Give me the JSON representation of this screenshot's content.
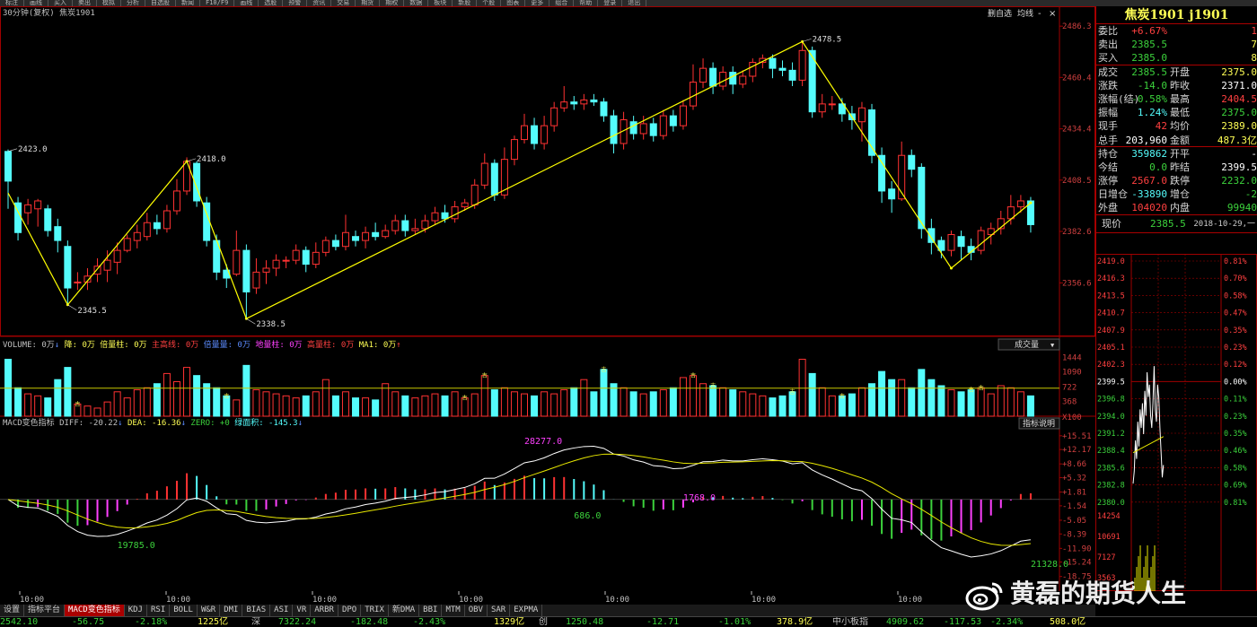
{
  "toolbar": [
    "标注",
    "画线",
    "买入",
    "卖出",
    "模拟",
    "分析",
    "自选股",
    "新闻",
    "F10/F9",
    "画线",
    "选股",
    "预警",
    "资讯",
    "交易",
    "期货",
    "期权",
    "数据",
    "板块",
    "新股",
    "个股",
    "图表",
    "更多",
    "组合",
    "帮助",
    "登录",
    "退出"
  ],
  "main_chart": {
    "header": "30分钟(复权) 焦炭1901",
    "controls": {
      "deselect": "删自选",
      "multi": "均线",
      "minus": "-",
      "close": "×"
    },
    "y_ticks": [
      "2486.3",
      "2460.4",
      "2434.4",
      "2408.5",
      "2382.6",
      "2356.6"
    ],
    "y_range": [
      2330,
      2490
    ],
    "candles": [
      [
        2423.0,
        2408,
        2424,
        2394
      ],
      [
        2397,
        2382,
        2400,
        2378
      ],
      [
        2392,
        2396,
        2399,
        2386
      ],
      [
        2394,
        2398,
        2399,
        2385
      ],
      [
        2394,
        2383,
        2396,
        2380
      ],
      [
        2385,
        2378,
        2389,
        2372
      ],
      [
        2375,
        2354,
        2378,
        2346
      ],
      [
        2357,
        2357,
        2362,
        2353
      ],
      [
        2357,
        2360,
        2364,
        2353
      ],
      [
        2361,
        2365,
        2369,
        2357
      ],
      [
        2363,
        2368,
        2373,
        2357
      ],
      [
        2367,
        2373,
        2377,
        2361
      ],
      [
        2373,
        2379,
        2381,
        2372
      ],
      [
        2378,
        2382,
        2386,
        2374
      ],
      [
        2380,
        2387,
        2392,
        2378
      ],
      [
        2387,
        2384,
        2391,
        2381
      ],
      [
        2384,
        2393,
        2396,
        2382
      ],
      [
        2393,
        2403,
        2409,
        2391
      ],
      [
        2403,
        2418,
        2420,
        2401
      ],
      [
        2417,
        2398,
        2418,
        2395
      ],
      [
        2397,
        2378,
        2400,
        2375
      ],
      [
        2378,
        2362,
        2381,
        2358
      ],
      [
        2363,
        2359,
        2366,
        2354
      ],
      [
        2361,
        2373,
        2383,
        2360
      ],
      [
        2373,
        2352,
        2376,
        2339
      ],
      [
        2354,
        2362,
        2369,
        2351
      ],
      [
        2362,
        2364,
        2368,
        2356
      ],
      [
        2364,
        2368,
        2371,
        2360
      ],
      [
        2368,
        2368,
        2370,
        2364
      ],
      [
        2368,
        2373,
        2376,
        2366
      ],
      [
        2373,
        2366,
        2375,
        2362
      ],
      [
        2366,
        2372,
        2377,
        2364
      ],
      [
        2372,
        2378,
        2380,
        2370
      ],
      [
        2378,
        2375,
        2381,
        2373
      ],
      [
        2375,
        2382,
        2391,
        2373
      ],
      [
        2380,
        2378,
        2383,
        2375
      ],
      [
        2378,
        2382,
        2385,
        2374
      ],
      [
        2382,
        2380,
        2387,
        2378
      ],
      [
        2380,
        2383,
        2386,
        2379
      ],
      [
        2383,
        2388,
        2391,
        2381
      ],
      [
        2388,
        2383,
        2391,
        2380
      ],
      [
        2383,
        2384,
        2389,
        2381
      ],
      [
        2384,
        2388,
        2391,
        2382
      ],
      [
        2388,
        2392,
        2395,
        2386
      ],
      [
        2392,
        2389,
        2396,
        2387
      ],
      [
        2389,
        2395,
        2398,
        2387
      ],
      [
        2395,
        2397,
        2399,
        2393
      ],
      [
        2396,
        2406,
        2409,
        2394
      ],
      [
        2406,
        2417,
        2422,
        2404
      ],
      [
        2417,
        2401,
        2419,
        2398
      ],
      [
        2401,
        2419,
        2425,
        2399
      ],
      [
        2419,
        2429,
        2431,
        2416
      ],
      [
        2429,
        2436,
        2442,
        2427
      ],
      [
        2436,
        2427,
        2440,
        2424
      ],
      [
        2427,
        2436,
        2441,
        2424
      ],
      [
        2436,
        2445,
        2448,
        2433
      ],
      [
        2445,
        2448,
        2456,
        2443
      ],
      [
        2448,
        2447,
        2451,
        2444
      ],
      [
        2447,
        2449,
        2452,
        2444
      ],
      [
        2449,
        2448,
        2452,
        2446
      ],
      [
        2448,
        2441,
        2450,
        2438
      ],
      [
        2441,
        2427,
        2444,
        2422
      ],
      [
        2427,
        2439,
        2443,
        2424
      ],
      [
        2438,
        2432,
        2441,
        2429
      ],
      [
        2432,
        2437,
        2441,
        2429
      ],
      [
        2437,
        2431,
        2440,
        2428
      ],
      [
        2431,
        2441,
        2444,
        2429
      ],
      [
        2441,
        2436,
        2444,
        2433
      ],
      [
        2436,
        2446,
        2449,
        2434
      ],
      [
        2446,
        2458,
        2467,
        2444
      ],
      [
        2458,
        2465,
        2470,
        2455
      ],
      [
        2465,
        2456,
        2468,
        2452
      ],
      [
        2456,
        2463,
        2466,
        2454
      ],
      [
        2463,
        2457,
        2466,
        2452
      ],
      [
        2457,
        2461,
        2464,
        2455
      ],
      [
        2461,
        2468,
        2470,
        2458
      ],
      [
        2468,
        2470,
        2472,
        2465
      ],
      [
        2470,
        2465,
        2472,
        2460
      ],
      [
        2465,
        2464,
        2469,
        2461
      ],
      [
        2464,
        2459,
        2468,
        2456
      ],
      [
        2459,
        2474,
        2478,
        2456
      ],
      [
        2474,
        2443,
        2476,
        2440
      ],
      [
        2443,
        2447,
        2452,
        2440
      ],
      [
        2447,
        2447,
        2451,
        2444
      ],
      [
        2447,
        2442,
        2450,
        2438
      ],
      [
        2442,
        2439,
        2446,
        2434
      ],
      [
        2438,
        2445,
        2448,
        2428
      ],
      [
        2444,
        2421,
        2447,
        2417
      ],
      [
        2421,
        2403,
        2425,
        2397
      ],
      [
        2404,
        2399,
        2408,
        2392
      ],
      [
        2399,
        2421,
        2428,
        2398
      ],
      [
        2421,
        2414,
        2424,
        2410
      ],
      [
        2415,
        2384,
        2417,
        2379
      ],
      [
        2384,
        2377,
        2389,
        2371
      ],
      [
        2378,
        2373,
        2380,
        2369
      ],
      [
        2373,
        2381,
        2383,
        2370
      ],
      [
        2380,
        2375,
        2383,
        2368
      ],
      [
        2375,
        2372,
        2379,
        2368
      ],
      [
        2373,
        2383,
        2385,
        2371
      ],
      [
        2381,
        2384,
        2387,
        2376
      ],
      [
        2384,
        2389,
        2393,
        2381
      ],
      [
        2389,
        2395,
        2401,
        2386
      ],
      [
        2395,
        2398,
        2401,
        2392
      ],
      [
        2398,
        2386,
        2400,
        2382
      ]
    ],
    "annotations": [
      {
        "i": 0,
        "price": 2423.0,
        "label": "2423.0",
        "pos": "above"
      },
      {
        "i": 6,
        "price": 2345.5,
        "label": "2345.5",
        "pos": "below"
      },
      {
        "i": 18,
        "price": 2418.0,
        "label": "2418.0",
        "pos": "above"
      },
      {
        "i": 24,
        "price": 2338.5,
        "label": "2338.5",
        "pos": "below"
      },
      {
        "i": 80,
        "price": 2478.5,
        "label": "2478.5",
        "pos": "above"
      }
    ],
    "zigzag": [
      [
        0,
        2402
      ],
      [
        6,
        2345.5
      ],
      [
        18,
        2418.0
      ],
      [
        24,
        2338.5
      ],
      [
        80,
        2478.5
      ],
      [
        95,
        2364
      ],
      [
        103,
        2397
      ]
    ]
  },
  "volume": {
    "header_parts": [
      {
        "t": "VOLUME: 0万",
        "c": "#c0c0c0"
      },
      {
        "t": "↓",
        "c": "#5c8cff"
      },
      {
        "t": " 降: 0万",
        "c": "#ffff55"
      },
      {
        "t": " 倍量柱: 0万",
        "c": "#ffff55"
      },
      {
        "t": " 主高线: 0万",
        "c": "#ff4040"
      },
      {
        "t": " 倍量量: 0万",
        "c": "#5c8cff"
      },
      {
        "t": " 地量柱: 0万",
        "c": "#ff40ff"
      },
      {
        "t": " 高量柱: 0万",
        "c": "#ff4040"
      },
      {
        "t": " MA1: 0万",
        "c": "#ffff55"
      },
      {
        "t": "↑",
        "c": "#ff4040"
      }
    ],
    "dropdown": "成交量",
    "y_ticks": [
      "1444",
      "1090",
      "722",
      "368",
      "X100"
    ],
    "values": [
      1400,
      700,
      550,
      500,
      450,
      900,
      1200,
      300,
      250,
      200,
      350,
      600,
      450,
      650,
      700,
      800,
      1050,
      850,
      1200,
      1000,
      800,
      700,
      500,
      400,
      1250,
      650,
      600,
      550,
      500,
      450,
      500,
      600,
      900,
      500,
      600,
      450,
      450,
      400,
      800,
      600,
      500,
      450,
      500,
      550,
      500,
      600,
      450,
      550,
      1000,
      650,
      700,
      600,
      550,
      500,
      600,
      550,
      650,
      700,
      900,
      600,
      1150,
      800,
      700,
      600,
      550,
      600,
      650,
      700,
      950,
      1000,
      800,
      750,
      700,
      650,
      600,
      550,
      500,
      450,
      500,
      600,
      1400,
      1050,
      700,
      500,
      500,
      550,
      700,
      800,
      1100,
      900,
      900,
      700,
      1150,
      900,
      750,
      650,
      600,
      650,
      700,
      550,
      750,
      700,
      600,
      500,
      600
    ],
    "ma_line": 690,
    "markers": [
      7,
      22,
      46,
      48,
      60,
      69,
      71,
      79,
      84,
      97,
      98,
      108
    ]
  },
  "macd": {
    "header_parts": [
      {
        "t": "MACD变色指标 DIFF: -20.22",
        "c": "#c0c0c0"
      },
      {
        "t": "↓",
        "c": "#5c8cff"
      },
      {
        "t": " DEA: -16.36",
        "c": "#ffff55"
      },
      {
        "t": "↓",
        "c": "#5c8cff"
      },
      {
        "t": " ZERO: +0",
        "c": "#3cd23c"
      },
      {
        "t": " 绿面积: -145.3",
        "c": "#54fcfc"
      },
      {
        "t": "↓",
        "c": "#5c8cff"
      }
    ],
    "button": "指标说明",
    "y_ticks": [
      "15.51",
      "12.17",
      "8.66",
      "5.32",
      "1.81",
      "-1.54",
      "-5.05",
      "-8.39",
      "-11.90",
      "-15.24",
      "-18.75"
    ],
    "labels": [
      {
        "t": "28277.0",
        "i": 52,
        "v": 13.5,
        "c": "#ff40ff"
      },
      {
        "t": "686.0",
        "i": 57,
        "v": -4.6,
        "c": "#3cd23c"
      },
      {
        "t": "1768.0",
        "i": 68,
        "v": -0.3,
        "c": "#ff40ff"
      },
      {
        "t": "19785.0",
        "i": 11,
        "v": -11.8,
        "c": "#3cd23c"
      },
      {
        "t": "21328.0",
        "i": 103,
        "v": -16.4,
        "c": "#3cd23c"
      }
    ]
  },
  "time_axis": [
    "10:00",
    "10:00",
    "10:00",
    "10:00",
    "10:00",
    "10:00",
    "10:00"
  ],
  "tabs": [
    "设置",
    "指标平台",
    "MACD变色指标",
    "KDJ",
    "RSI",
    "BOLL",
    "W&R",
    "DMI",
    "BIAS",
    "ASI",
    "VR",
    "ARBR",
    "DPO",
    "TRIX",
    "新DMA",
    "BBI",
    "MTM",
    "OBV",
    "SAR",
    "EXPMA"
  ],
  "panel": {
    "title": "焦炭1901 j1901",
    "rows": [
      {
        "l": "委比",
        "v": "+6.67%",
        "vc": "red",
        "l2": "",
        "v2": "1",
        "v2c": "red"
      },
      {
        "l": "卖出",
        "v": "2385.5",
        "vc": "grn",
        "l2": "",
        "v2": "7",
        "v2c": "yel"
      },
      {
        "l": "买入",
        "v": "2385.0",
        "vc": "grn",
        "l2": "",
        "v2": "8",
        "v2c": "yel",
        "sep": true
      },
      {
        "l": "成交",
        "v": "2385.5",
        "vc": "grn",
        "l2": "开盘",
        "v2": "2375.0",
        "v2c": "yel"
      },
      {
        "l": "涨跌",
        "v": "-14.0",
        "vc": "grn",
        "l2": "昨收",
        "v2": "2371.0",
        "v2c": "wht"
      },
      {
        "l": "涨幅(结)",
        "v": "-0.58%",
        "vc": "grn",
        "l2": "最高",
        "v2": "2404.5",
        "v2c": "red"
      },
      {
        "l": "振幅",
        "v": "1.24%",
        "vc": "cyn",
        "l2": "最低",
        "v2": "2375.0",
        "v2c": "grn"
      },
      {
        "l": "现手",
        "v": "42",
        "vc": "red",
        "l2": "均价",
        "v2": "2389.0",
        "v2c": "yel"
      },
      {
        "l": "总手",
        "v": "203,960",
        "vc": "wht",
        "l2": "金额",
        "v2": "487.3亿",
        "v2c": "yel",
        "sep": true
      },
      {
        "l": "持仓",
        "v": "359862",
        "vc": "cyn",
        "l2": "开平",
        "v2": "-",
        "v2c": "wht"
      },
      {
        "l": "今结",
        "v": "0.0",
        "vc": "grn",
        "l2": "昨结",
        "v2": "2399.5",
        "v2c": "wht"
      },
      {
        "l": "涨停",
        "v": "2567.0",
        "vc": "red",
        "l2": "跌停",
        "v2": "2232.0",
        "v2c": "grn"
      },
      {
        "l": "日增仓",
        "v": "-33890",
        "vc": "cyn",
        "l2": "增仓",
        "v2": "-2",
        "v2c": "grn"
      },
      {
        "l": "外盘",
        "v": "104020",
        "vc": "red",
        "l2": "内盘",
        "v2": "99940",
        "v2c": "grn",
        "sep": true
      }
    ],
    "now_label": "现价",
    "now_value": "2385.5",
    "now_time": "2018-10-29,一",
    "mini_left": [
      "2419.0",
      "2416.3",
      "2413.5",
      "2410.7",
      "2407.9",
      "2405.1",
      "2402.3",
      "2399.5",
      "2396.8",
      "2394.0",
      "2391.2",
      "2388.4",
      "2385.6",
      "2382.8",
      "2380.0"
    ],
    "mini_right": [
      "0.81%",
      "0.70%",
      "0.58%",
      "0.47%",
      "0.35%",
      "0.23%",
      "0.12%",
      "0.00%",
      "0.11%",
      "0.23%",
      "0.35%",
      "0.46%",
      "0.58%",
      "0.69%",
      "0.81%"
    ],
    "mini_vol": [
      "14254",
      "10691",
      "7127",
      "3563"
    ]
  },
  "status": [
    {
      "t": "2542.10",
      "c": "#3cd23c",
      "w": 80
    },
    {
      "t": "-56.75",
      "c": "#3cd23c",
      "w": 70
    },
    {
      "t": "-2.18%",
      "c": "#3cd23c",
      "w": 70
    },
    {
      "t": "1225亿",
      "c": "#ffff55",
      "w": 60
    },
    {
      "t": "深",
      "c": "#c0c0c0",
      "w": 30
    },
    {
      "t": "7322.24",
      "c": "#3cd23c",
      "w": 80
    },
    {
      "t": "-182.48",
      "c": "#3cd23c",
      "w": 70
    },
    {
      "t": "-2.43%",
      "c": "#3cd23c",
      "w": 90
    },
    {
      "t": "1329亿",
      "c": "#ffff55",
      "w": 50
    },
    {
      "t": "创",
      "c": "#c0c0c0",
      "w": 30
    },
    {
      "t": "1250.48",
      "c": "#3cd23c",
      "w": 90
    },
    {
      "t": "-12.71",
      "c": "#3cd23c",
      "w": 80
    },
    {
      "t": "-1.01%",
      "c": "#3cd23c",
      "w": 65
    },
    {
      "t": "378.9亿",
      "c": "#ffff55",
      "w": 62
    },
    {
      "t": "中小板指",
      "c": "#c0c0c0",
      "w": 60
    },
    {
      "t": "4909.62",
      "c": "#3cd23c",
      "w": 64
    },
    {
      "t": "-117.53",
      "c": "#3cd23c",
      "w": 52
    },
    {
      "t": "-2.34%",
      "c": "#3cd23c",
      "w": 66
    },
    {
      "t": "508.0亿",
      "c": "#ffff55",
      "w": 50
    }
  ],
  "watermark": "黄磊的期货人生",
  "colors": {
    "up": "#ff3232",
    "down": "#54fcfc",
    "zig": "#ffff00",
    "grid": "#a00000",
    "macd_pos": "#ff3232",
    "macd_neg": "#54fcfc",
    "macd_neg2": "#3cd23c",
    "macd_mag": "#ff40ff"
  }
}
